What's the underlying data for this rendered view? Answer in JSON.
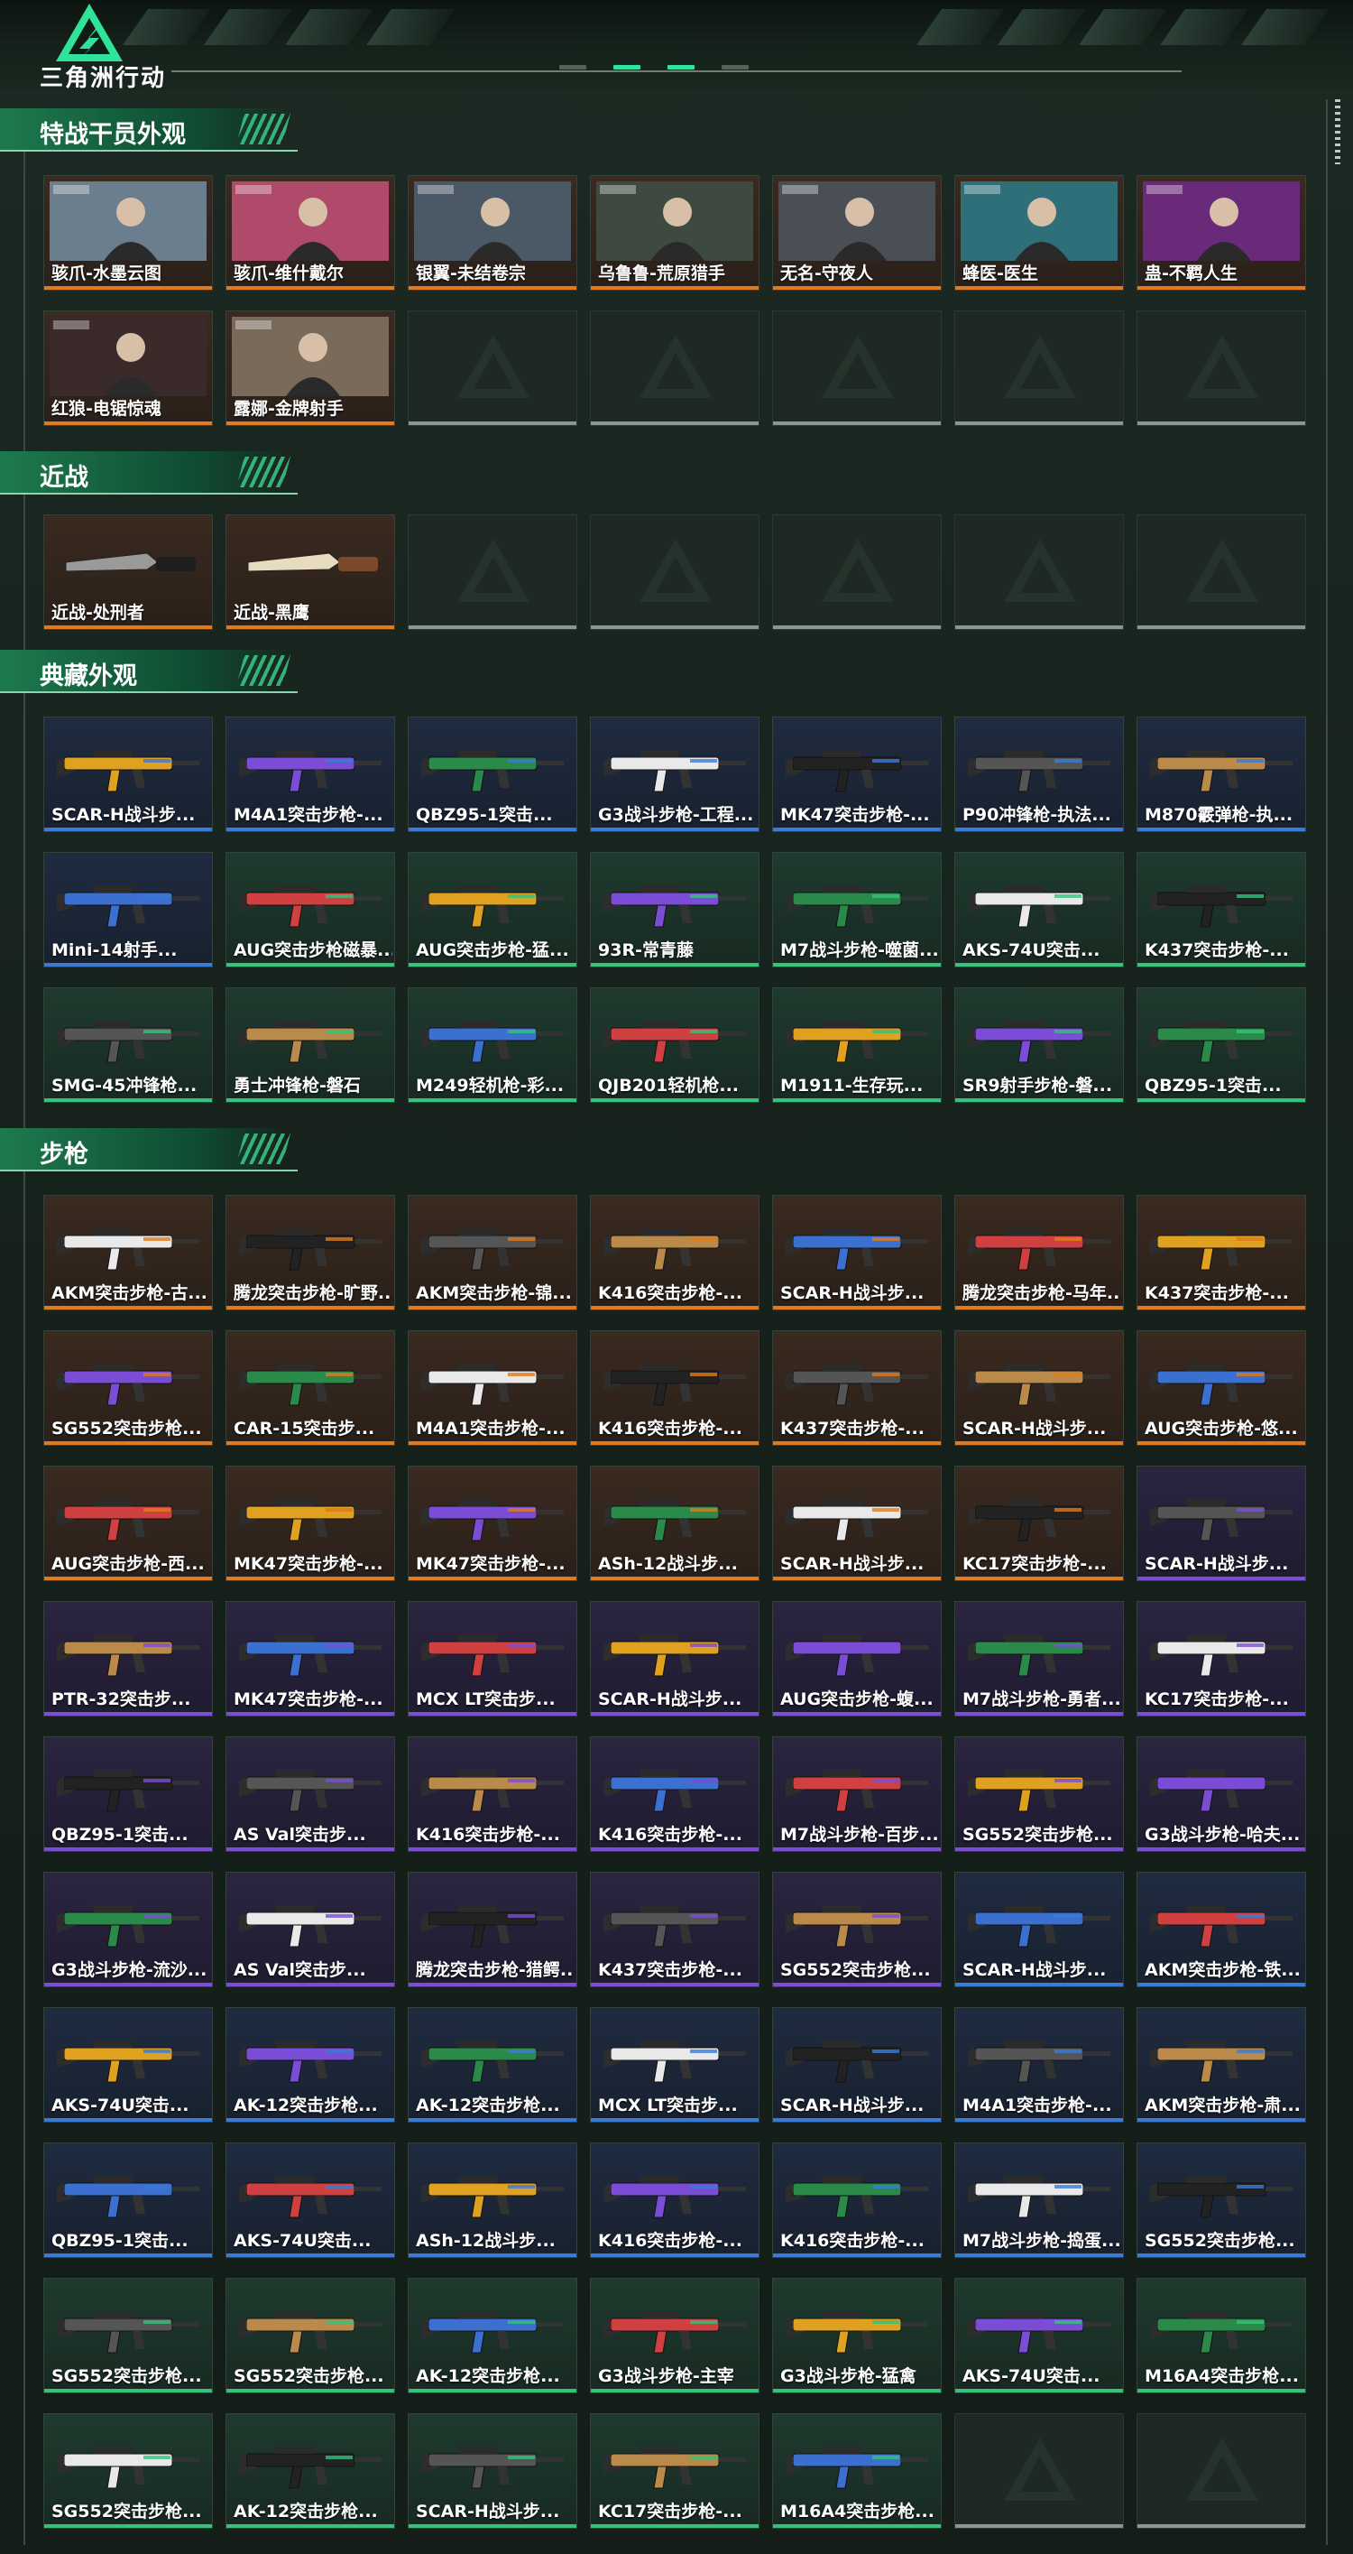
{
  "header": {
    "logo_text": "三角洲行动",
    "pager_count": 4,
    "active_pager": 1
  },
  "colors": {
    "orange": "#e07a1a",
    "purple": "#7b4dd6",
    "blue": "#3a7bd5",
    "green": "#35c27a",
    "accent": "#2ee39a"
  },
  "sections": [
    {
      "title": "特战干员外观",
      "kind": "portrait",
      "items": [
        {
          "label": "骇爪-水墨云图",
          "rarity": "orange"
        },
        {
          "label": "骇爪-维什戴尔",
          "rarity": "orange"
        },
        {
          "label": "银翼-未结卷宗",
          "rarity": "orange"
        },
        {
          "label": "乌鲁鲁-荒原猎手",
          "rarity": "orange"
        },
        {
          "label": "无名-守夜人",
          "rarity": "orange"
        },
        {
          "label": "蜂医-医生",
          "rarity": "orange"
        },
        {
          "label": "蛊-不羁人生",
          "rarity": "orange"
        },
        {
          "label": "红狼-电锯惊魂",
          "rarity": "orange"
        },
        {
          "label": "露娜-金牌射手",
          "rarity": "orange"
        }
      ],
      "empty_slots": 5
    },
    {
      "title": "近战",
      "kind": "melee",
      "items": [
        {
          "label": "近战-处刑者",
          "rarity": "orange"
        },
        {
          "label": "近战-黑鹰",
          "rarity": "orange"
        }
      ],
      "empty_slots": 5
    },
    {
      "title": "典藏外观",
      "kind": "gun",
      "items": [
        {
          "label": "SCAR-H战斗步...",
          "rarity": "blue"
        },
        {
          "label": "M4A1突击步枪-...",
          "rarity": "blue"
        },
        {
          "label": "QBZ95-1突击...",
          "rarity": "blue"
        },
        {
          "label": "G3战斗步枪-工程...",
          "rarity": "blue"
        },
        {
          "label": "MK47突击步枪-...",
          "rarity": "blue"
        },
        {
          "label": "P90冲锋枪-执法...",
          "rarity": "blue"
        },
        {
          "label": "M870霰弹枪-执...",
          "rarity": "blue"
        },
        {
          "label": "Mini-14射手...",
          "rarity": "blue"
        },
        {
          "label": "AUG突击步枪磁暴...",
          "rarity": "green"
        },
        {
          "label": "AUG突击步枪-猛...",
          "rarity": "green"
        },
        {
          "label": "93R-常青藤",
          "rarity": "green"
        },
        {
          "label": "M7战斗步枪-噬菌...",
          "rarity": "green"
        },
        {
          "label": "AKS-74U突击...",
          "rarity": "green"
        },
        {
          "label": "K437突击步枪-...",
          "rarity": "green"
        },
        {
          "label": "SMG-45冲锋枪...",
          "rarity": "green"
        },
        {
          "label": "勇士冲锋枪-磐石",
          "rarity": "green"
        },
        {
          "label": "M249轻机枪-彩...",
          "rarity": "green"
        },
        {
          "label": "QJB201轻机枪...",
          "rarity": "green"
        },
        {
          "label": "M1911-生存玩...",
          "rarity": "green"
        },
        {
          "label": "SR9射手步枪-磐...",
          "rarity": "green"
        },
        {
          "label": "QBZ95-1突击...",
          "rarity": "green"
        }
      ],
      "empty_slots": 0
    },
    {
      "title": "步枪",
      "kind": "gun",
      "items": [
        {
          "label": "AKM突击步枪-古...",
          "rarity": "orange"
        },
        {
          "label": "腾龙突击步枪-旷野...",
          "rarity": "orange"
        },
        {
          "label": "AKM突击步枪-锦...",
          "rarity": "orange"
        },
        {
          "label": "K416突击步枪-...",
          "rarity": "orange"
        },
        {
          "label": "SCAR-H战斗步...",
          "rarity": "orange"
        },
        {
          "label": "腾龙突击步枪-马年...",
          "rarity": "orange"
        },
        {
          "label": "K437突击步枪-...",
          "rarity": "orange"
        },
        {
          "label": "SG552突击步枪...",
          "rarity": "orange"
        },
        {
          "label": "CAR-15突击步...",
          "rarity": "orange"
        },
        {
          "label": "M4A1突击步枪-...",
          "rarity": "orange"
        },
        {
          "label": "K416突击步枪-...",
          "rarity": "orange"
        },
        {
          "label": "K437突击步枪-...",
          "rarity": "orange"
        },
        {
          "label": "SCAR-H战斗步...",
          "rarity": "orange"
        },
        {
          "label": "AUG突击步枪-悠...",
          "rarity": "orange"
        },
        {
          "label": "AUG突击步枪-西...",
          "rarity": "orange"
        },
        {
          "label": "MK47突击步枪-...",
          "rarity": "orange"
        },
        {
          "label": "MK47突击步枪-...",
          "rarity": "orange"
        },
        {
          "label": "ASh-12战斗步...",
          "rarity": "orange"
        },
        {
          "label": "SCAR-H战斗步...",
          "rarity": "orange"
        },
        {
          "label": "KC17突击步枪-...",
          "rarity": "orange"
        },
        {
          "label": "SCAR-H战斗步...",
          "rarity": "purple"
        },
        {
          "label": "PTR-32突击步...",
          "rarity": "purple"
        },
        {
          "label": "MK47突击步枪-...",
          "rarity": "purple"
        },
        {
          "label": "MCX LT突击步...",
          "rarity": "purple"
        },
        {
          "label": "SCAR-H战斗步...",
          "rarity": "purple"
        },
        {
          "label": "AUG突击步枪-蝮...",
          "rarity": "purple"
        },
        {
          "label": "M7战斗步枪-勇者...",
          "rarity": "purple"
        },
        {
          "label": "KC17突击步枪-...",
          "rarity": "purple"
        },
        {
          "label": "QBZ95-1突击...",
          "rarity": "purple"
        },
        {
          "label": "AS Val突击步...",
          "rarity": "purple"
        },
        {
          "label": "K416突击步枪-...",
          "rarity": "purple"
        },
        {
          "label": "K416突击步枪-...",
          "rarity": "purple"
        },
        {
          "label": "M7战斗步枪-百步...",
          "rarity": "purple"
        },
        {
          "label": "SG552突击步枪...",
          "rarity": "purple"
        },
        {
          "label": "G3战斗步枪-哈夫...",
          "rarity": "purple"
        },
        {
          "label": "G3战斗步枪-流沙...",
          "rarity": "purple"
        },
        {
          "label": "AS Val突击步...",
          "rarity": "purple"
        },
        {
          "label": "腾龙突击步枪-猎鳄...",
          "rarity": "purple"
        },
        {
          "label": "K437突击步枪-...",
          "rarity": "purple"
        },
        {
          "label": "SG552突击步枪...",
          "rarity": "purple"
        },
        {
          "label": "SCAR-H战斗步...",
          "rarity": "blue"
        },
        {
          "label": "AKM突击步枪-铁...",
          "rarity": "blue"
        },
        {
          "label": "AKS-74U突击...",
          "rarity": "blue"
        },
        {
          "label": "AK-12突击步枪...",
          "rarity": "blue"
        },
        {
          "label": "AK-12突击步枪...",
          "rarity": "blue"
        },
        {
          "label": "MCX LT突击步...",
          "rarity": "blue"
        },
        {
          "label": "SCAR-H战斗步...",
          "rarity": "blue"
        },
        {
          "label": "M4A1突击步枪-...",
          "rarity": "blue"
        },
        {
          "label": "AKM突击步枪-肃...",
          "rarity": "blue"
        },
        {
          "label": "QBZ95-1突击...",
          "rarity": "blue"
        },
        {
          "label": "AKS-74U突击...",
          "rarity": "blue"
        },
        {
          "label": "ASh-12战斗步...",
          "rarity": "blue"
        },
        {
          "label": "K416突击步枪-...",
          "rarity": "blue"
        },
        {
          "label": "K416突击步枪-...",
          "rarity": "blue"
        },
        {
          "label": "M7战斗步枪-捣蛋...",
          "rarity": "blue"
        },
        {
          "label": "SG552突击步枪...",
          "rarity": "blue"
        },
        {
          "label": "SG552突击步枪...",
          "rarity": "green"
        },
        {
          "label": "SG552突击步枪...",
          "rarity": "green"
        },
        {
          "label": "AK-12突击步枪...",
          "rarity": "green"
        },
        {
          "label": "G3战斗步枪-主宰",
          "rarity": "green"
        },
        {
          "label": "G3战斗步枪-猛禽",
          "rarity": "green"
        },
        {
          "label": "AKS-74U突击...",
          "rarity": "green"
        },
        {
          "label": "M16A4突击步枪...",
          "rarity": "green"
        },
        {
          "label": "SG552突击步枪...",
          "rarity": "green"
        },
        {
          "label": "AK-12突击步枪...",
          "rarity": "green"
        },
        {
          "label": "SCAR-H战斗步...",
          "rarity": "green"
        },
        {
          "label": "KC17突击步枪-...",
          "rarity": "green"
        },
        {
          "label": "M16A4突击步枪...",
          "rarity": "green"
        }
      ],
      "empty_slots": 2
    }
  ]
}
